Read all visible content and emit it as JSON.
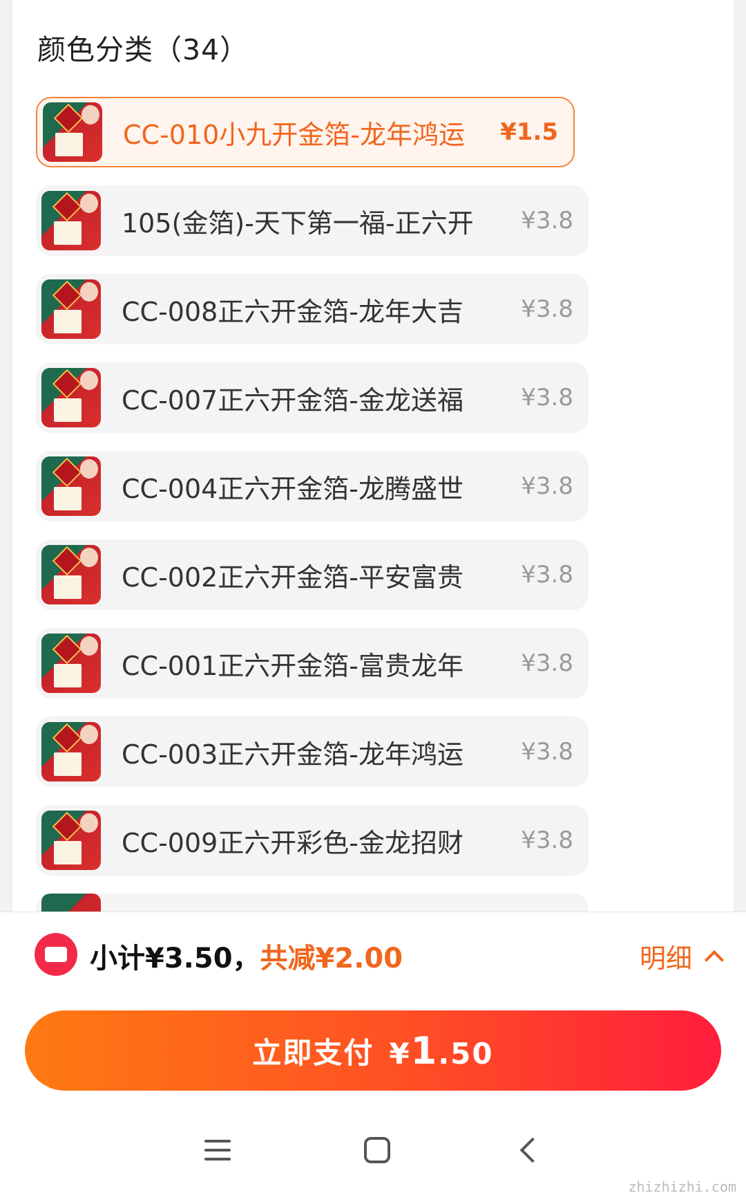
{
  "section": {
    "title": "颜色分类（34）"
  },
  "sku_items": [
    {
      "name": "CC-010小九开金箔-龙年鸿运",
      "price": "¥1.5",
      "selected": true
    },
    {
      "name": "105(金箔)-天下第一福-正六开",
      "price": "¥3.8",
      "selected": false
    },
    {
      "name": "CC-008正六开金箔-龙年大吉",
      "price": "¥3.8",
      "selected": false
    },
    {
      "name": "CC-007正六开金箔-金龙送福",
      "price": "¥3.8",
      "selected": false
    },
    {
      "name": "CC-004正六开金箔-龙腾盛世",
      "price": "¥3.8",
      "selected": false
    },
    {
      "name": "CC-002正六开金箔-平安富贵",
      "price": "¥3.8",
      "selected": false
    },
    {
      "name": "CC-001正六开金箔-富贵龙年",
      "price": "¥3.8",
      "selected": false
    },
    {
      "name": "CC-003正六开金箔-龙年鸿运",
      "price": "¥3.8",
      "selected": false
    },
    {
      "name": "CC-009正六开彩色-金龙招财",
      "price": "¥3.8",
      "selected": false
    }
  ],
  "summary": {
    "subtotal": "小计¥3.50，",
    "discount": "共减¥2.00",
    "detail_label": "明细"
  },
  "pay_button": {
    "label": "立即支付",
    "currency": "¥",
    "amount_int": "1",
    "amount_dec": ".50"
  },
  "watermark": "zhizhizhi.com",
  "colors": {
    "accent": "#f0661d",
    "pay_start": "#ff7a12",
    "pay_end": "#ff1e3c",
    "coupon": "#f3294a"
  }
}
